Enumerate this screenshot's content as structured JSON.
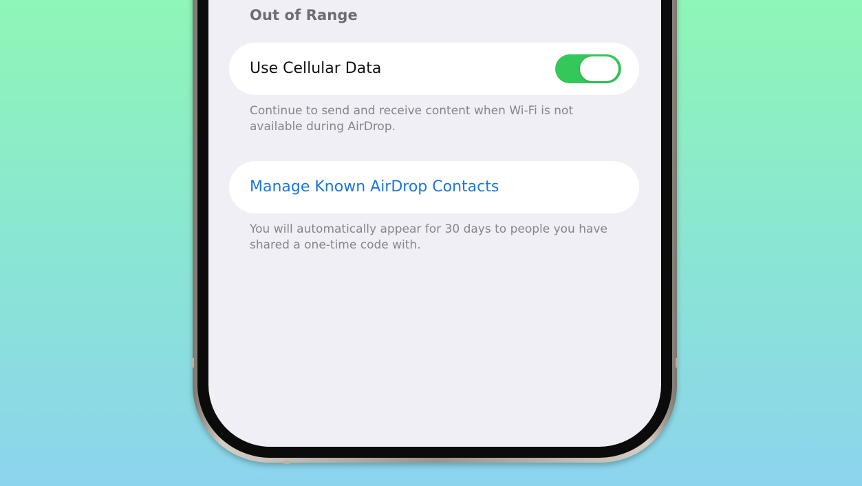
{
  "section": {
    "header": "Out of Range"
  },
  "cellular": {
    "label": "Use Cellular Data",
    "toggle_on": true,
    "footer": "Continue to send and receive content when Wi-Fi is not available during AirDrop."
  },
  "contacts": {
    "link_label": "Manage Known AirDrop Contacts",
    "footer": "You will automatically appear for 30 days to people you have shared a one-time code with."
  },
  "colors": {
    "toggle_on": "#34c759",
    "link": "#1a78d8",
    "screen_bg": "#f0eff5",
    "background_top": "#8ef6b6",
    "background_bottom": "#8cd4ee"
  },
  "icons": {
    "toggle": "toggle-switch-icon"
  }
}
